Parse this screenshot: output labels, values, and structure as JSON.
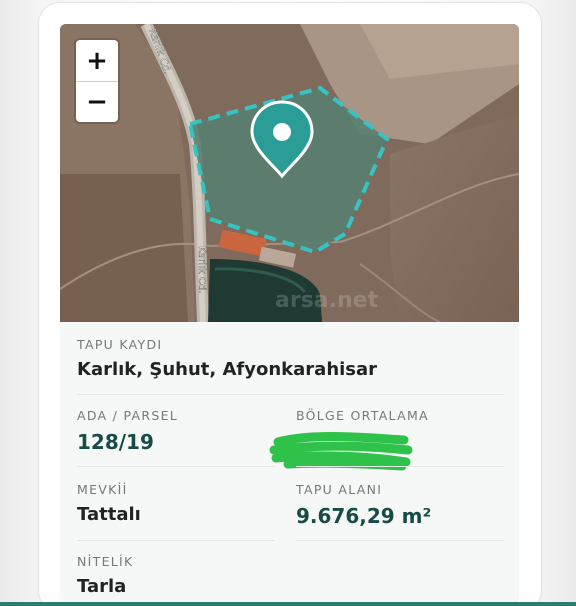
{
  "map": {
    "road_label_top": "Karlık Cd.",
    "road_label_bottom": "Karlık Cd.",
    "watermark": "arsa.net",
    "zoom_in_label": "+",
    "zoom_out_label": "−",
    "parcel_color": "#37c3c1",
    "pin_color": "#2a9d96",
    "pin_icon": "map-pin-icon"
  },
  "details": {
    "deed_record": {
      "label": "TAPU KAYDI",
      "value": "Karlık, Şuhut, Afyonkarahisar"
    },
    "block_parcel": {
      "label": "ADA / PARSEL",
      "value": "128/19"
    },
    "region_average": {
      "label": "BÖLGE ORTALAMA",
      "value": ""
    },
    "locality": {
      "label": "MEVKİİ",
      "value": "Tattalı"
    },
    "deed_area": {
      "label": "TAPU ALANI",
      "value": "9.676,29 m²"
    },
    "quality": {
      "label": "NİTELİK",
      "value": "Tarla"
    }
  },
  "colors": {
    "accent_text": "#174c46",
    "label_text": "#737a77",
    "redaction": "#2fc24a"
  }
}
